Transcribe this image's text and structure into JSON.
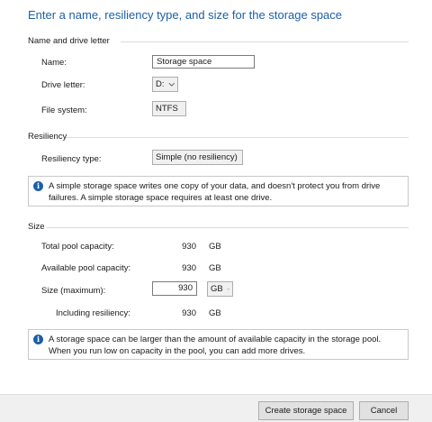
{
  "dialog": {
    "title": "Enter a name, resiliency type, and size for the storage space"
  },
  "name_section": {
    "header": "Name and drive letter",
    "name_label": "Name:",
    "name_value": "Storage space",
    "drive_letter_label": "Drive letter:",
    "drive_letter_value": "D:",
    "file_system_label": "File system:",
    "file_system_value": "NTFS"
  },
  "resiliency_section": {
    "header": "Resiliency",
    "type_label": "Resiliency type:",
    "type_value": "Simple (no resiliency)",
    "info": "A simple storage space writes one copy of your data, and doesn't protect you from drive failures. A simple storage space requires at least one drive."
  },
  "size_section": {
    "header": "Size",
    "total_label": "Total pool capacity:",
    "total_value": "930",
    "total_unit": "GB",
    "available_label": "Available pool capacity:",
    "available_value": "930",
    "available_unit": "GB",
    "size_label": "Size (maximum):",
    "size_value": "930",
    "size_unit": "GB",
    "including_label": "Including resiliency:",
    "including_value": "930",
    "including_unit": "GB",
    "info": "A storage space can be larger than the amount of available capacity in the storage pool. When you run low on capacity in the pool, you can add more drives."
  },
  "footer": {
    "create_label": "Create storage space",
    "cancel_label": "Cancel"
  },
  "icons": {
    "info": "info-icon",
    "dropdown": "chevron-down-icon"
  },
  "colors": {
    "title": "#1c5fa8",
    "info_icon": "#1c5fa8",
    "footer_bg": "#f0f0f0"
  }
}
